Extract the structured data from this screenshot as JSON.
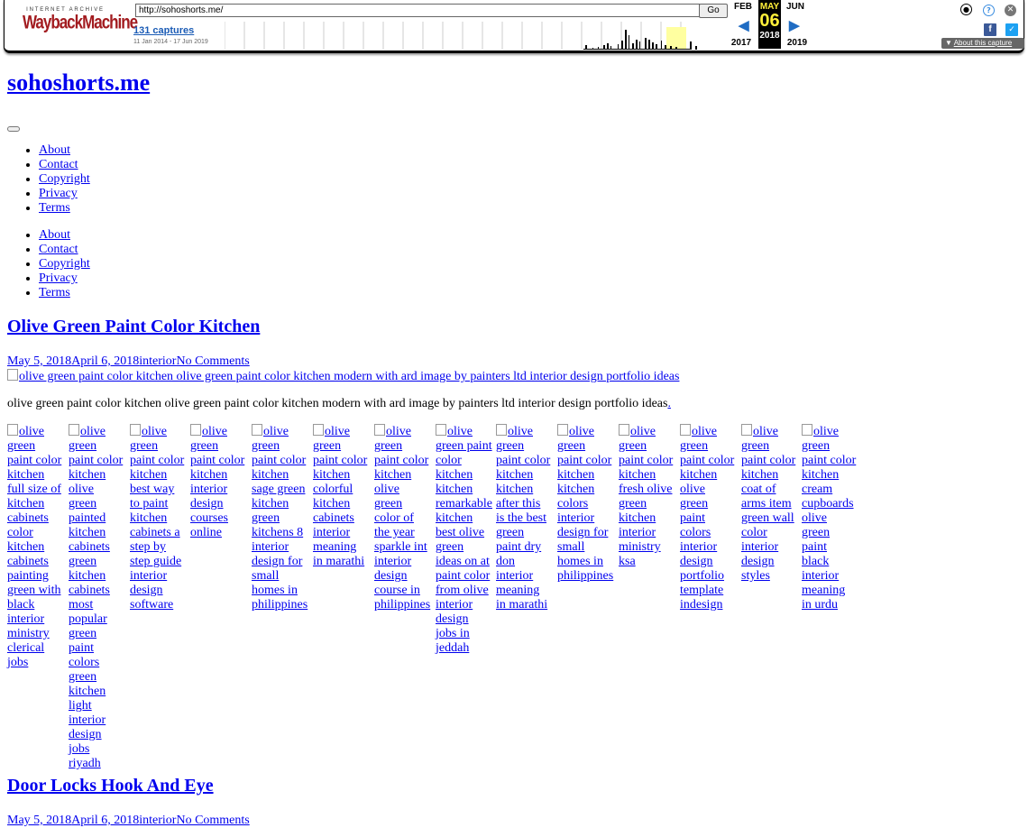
{
  "wayback": {
    "logo_top": "INTERNET ARCHIVE",
    "logo_main": "WaybackMachine",
    "url_value": "http://sohoshorts.me/",
    "go_label": "Go",
    "captures": "131 captures",
    "range": "11 Jan 2014 - 17 Jun 2019",
    "prev_month": "FEB",
    "cur_month": "MAY",
    "next_month": "JUN",
    "cur_day": "06",
    "prev_year": "2017",
    "cur_year": "2018",
    "next_year": "2019",
    "about_label": "About this capture",
    "accent": "#a21b1f"
  },
  "site": {
    "title": "sohoshorts.me",
    "menu": [
      "About",
      "Contact",
      "Copyright",
      "Privacy",
      "Terms"
    ]
  },
  "post1": {
    "title": "Olive Green Paint Color Kitchen",
    "date1": "May 5, 2018",
    "date2": "April 6, 2018",
    "category": "interior",
    "comments": "No Comments",
    "image_alt": "olive green paint color kitchen olive green paint color kitchen modern with ard image by painters ltd interior design portfolio ideas",
    "text": "olive green paint color kitchen olive green paint color kitchen modern with ard image by painters ltd interior design portfolio ideas",
    "text_link": ".",
    "gallery": [
      [
        "olive",
        "green",
        "paint color",
        "kitchen",
        "full size of",
        "kitchen",
        "cabinets",
        "color",
        "kitchen",
        "cabinets",
        "painting",
        "green with",
        "black",
        "interior",
        "ministry",
        "clerical",
        "jobs"
      ],
      [
        "olive",
        "green",
        "paint color",
        "kitchen",
        "olive",
        "green",
        "painted",
        "kitchen",
        "cabinets",
        "green",
        "kitchen",
        "cabinets",
        "most",
        "popular",
        "green",
        "paint",
        "colors",
        "green",
        "kitchen",
        "light",
        "interior",
        "design",
        "jobs",
        "riyadh"
      ],
      [
        "olive",
        "green",
        "paint color",
        "kitchen",
        "best way",
        "to paint",
        "kitchen",
        "cabinets a",
        "step by",
        "step guide",
        "interior",
        "design",
        "software"
      ],
      [
        "olive",
        "green",
        "paint color",
        "kitchen",
        "interior",
        "design",
        "courses",
        "online"
      ],
      [
        "olive",
        "green",
        "paint color",
        "kitchen",
        "sage green",
        "kitchen",
        "green",
        "kitchens 8",
        "interior",
        "design for",
        "small",
        "homes in",
        "philippines"
      ],
      [
        "olive",
        "green",
        "paint color",
        "kitchen",
        "colorful",
        "kitchen",
        "cabinets",
        "interior",
        "meaning",
        "in marathi"
      ],
      [
        "olive",
        "green",
        "paint color",
        "kitchen",
        "olive",
        "green",
        "color of",
        "the year",
        "sparkle int",
        "interior",
        "design",
        "course in",
        "philippines"
      ],
      [
        "olive",
        "green paint",
        "color",
        "kitchen",
        "kitchen",
        "remarkable",
        "kitchen",
        "best olive",
        "green",
        "ideas on at",
        "paint color",
        "from olive",
        "interior",
        "design",
        "jobs in",
        "jeddah"
      ],
      [
        "olive",
        "green",
        "paint color",
        "kitchen",
        "kitchen",
        "after this",
        "is the best",
        "green",
        "paint dry",
        "don",
        "interior",
        "meaning",
        "in marathi"
      ],
      [
        "olive",
        "green",
        "paint color",
        "kitchen",
        "kitchen",
        "colors",
        "interior",
        "design for",
        "small",
        "homes in",
        "philippines"
      ],
      [
        "olive",
        "green",
        "paint color",
        "kitchen",
        "fresh olive",
        "green",
        "kitchen",
        "interior",
        "ministry",
        "ksa"
      ],
      [
        "olive",
        "green",
        "paint color",
        "kitchen",
        "olive",
        "green",
        "paint",
        "colors",
        "interior",
        "design",
        "portfolio",
        "template",
        "indesign"
      ],
      [
        "olive",
        "green",
        "paint color",
        "kitchen",
        "coat of",
        "arms item",
        "green wall",
        "color",
        "interior",
        "design",
        "styles"
      ],
      [
        "olive",
        "green",
        "paint color",
        "kitchen",
        "cream",
        "cupboards",
        "olive",
        "green",
        "paint",
        "black",
        "interior",
        "meaning",
        "in urdu"
      ]
    ]
  },
  "post2": {
    "title": "Door Locks Hook And Eye",
    "date1": "May 5, 2018",
    "date2": "April 6, 2018",
    "category": "interior",
    "comments": "No Comments"
  }
}
